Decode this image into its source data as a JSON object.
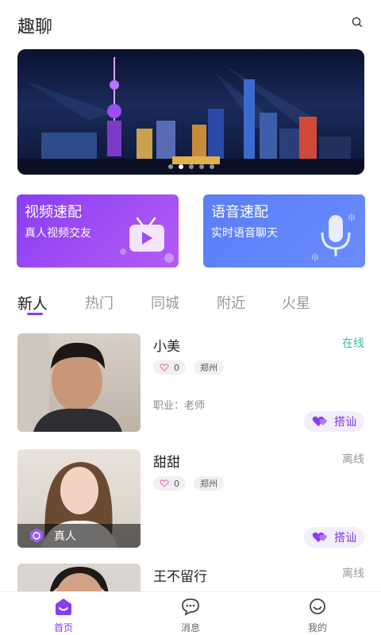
{
  "header": {
    "title": "趣聊"
  },
  "quick_match": {
    "video": {
      "title": "视频速配",
      "subtitle": "真人视频交友"
    },
    "voice": {
      "title": "语音速配",
      "subtitle": "实时语音聊天"
    }
  },
  "tabs": [
    "新人",
    "热门",
    "同城",
    "附近",
    "火星"
  ],
  "active_tab": "新人",
  "users": [
    {
      "name": "小美",
      "status": "在线",
      "likes": "0",
      "city": "郑州",
      "job": "职业：老师",
      "action": "搭讪",
      "verified": ""
    },
    {
      "name": "甜甜",
      "status": "离线",
      "likes": "0",
      "city": "郑州",
      "job": "",
      "action": "搭讪",
      "verified": "真人"
    },
    {
      "name": "王不留行",
      "status": "离线"
    }
  ],
  "bottom_nav": [
    {
      "label": "首页",
      "icon": "home-icon",
      "active": true
    },
    {
      "label": "消息",
      "icon": "message-icon",
      "active": false
    },
    {
      "label": "我的",
      "icon": "profile-icon",
      "active": false
    }
  ],
  "colors": {
    "accent": "#8a3df2",
    "online": "#38c58f",
    "voice_card": "#5b7df5"
  }
}
